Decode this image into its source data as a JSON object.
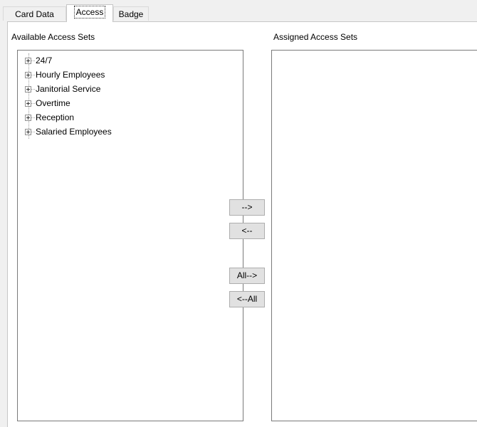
{
  "tabs": [
    {
      "label": "Card Data"
    },
    {
      "label": "Access"
    },
    {
      "label": "Badge"
    }
  ],
  "active_tab": "Access",
  "available": {
    "label": "Available Access Sets",
    "items": [
      {
        "label": "24/7"
      },
      {
        "label": "Hourly Employees"
      },
      {
        "label": "Janitorial Service"
      },
      {
        "label": "Overtime"
      },
      {
        "label": "Reception"
      },
      {
        "label": "Salaried Employees"
      }
    ]
  },
  "assigned": {
    "label": "Assigned Access Sets",
    "items": []
  },
  "buttons": {
    "add": "-->",
    "remove": "<--",
    "add_all": "All-->",
    "remove_all": "<--All"
  }
}
